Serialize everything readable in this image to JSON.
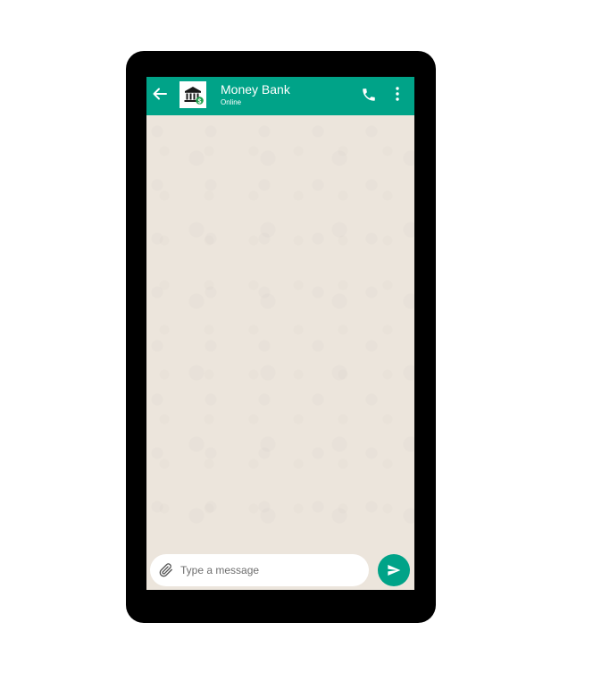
{
  "header": {
    "contact_name": "Money Bank",
    "contact_status": "Online",
    "avatar_icon": "bank-icon",
    "back_icon": "arrow-left-icon",
    "call_icon": "phone-icon",
    "menu_icon": "more-vertical-icon"
  },
  "composer": {
    "placeholder": "Type a message",
    "value": "",
    "attach_icon": "paperclip-icon",
    "send_icon": "send-icon"
  },
  "colors": {
    "accent": "#00a388",
    "chat_background": "#ece5dc",
    "device_frame": "#000000"
  }
}
